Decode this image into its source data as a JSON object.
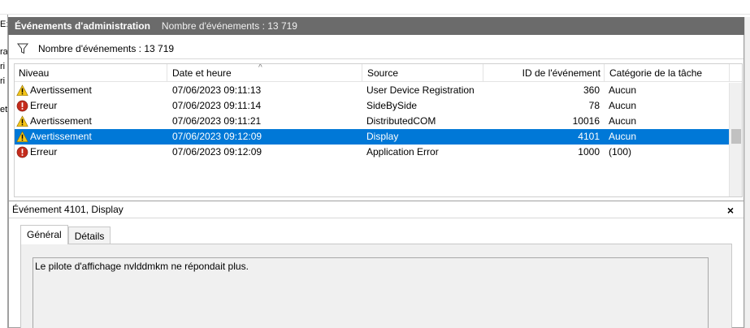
{
  "left_fragments": [
    "E:",
    "ra",
    "ri",
    "ri",
    "et"
  ],
  "header": {
    "title": "Événements d'administration",
    "count": "Nombre d'événements : 13 719"
  },
  "filterbar": {
    "icon": "filter-icon",
    "label": "Nombre d'événements : 13 719"
  },
  "columns": [
    "Niveau",
    "Date et heure",
    "Source",
    "ID de l'événement",
    "Catégorie de la tâche"
  ],
  "events": [
    {
      "level": "Avertissement",
      "icon": "warning-icon",
      "datetime": "07/06/2023 09:11:13",
      "source": "User Device Registration",
      "id": "360",
      "category": "Aucun",
      "selected": false
    },
    {
      "level": "Erreur",
      "icon": "error-icon",
      "datetime": "07/06/2023 09:11:14",
      "source": "SideBySide",
      "id": "78",
      "category": "Aucun",
      "selected": false
    },
    {
      "level": "Avertissement",
      "icon": "warning-icon",
      "datetime": "07/06/2023 09:11:21",
      "source": "DistributedCOM",
      "id": "10016",
      "category": "Aucun",
      "selected": false
    },
    {
      "level": "Avertissement",
      "icon": "warning-icon",
      "datetime": "07/06/2023 09:12:09",
      "source": "Display",
      "id": "4101",
      "category": "Aucun",
      "selected": true
    },
    {
      "level": "Erreur",
      "icon": "error-icon",
      "datetime": "07/06/2023 09:12:09",
      "source": "Application Error",
      "id": "1000",
      "category": "(100)",
      "selected": false
    }
  ],
  "detail": {
    "title": "Événement 4101, Display",
    "close": "×",
    "tabs": [
      "Général",
      "Détails"
    ],
    "active_tab": "Général",
    "message": "Le pilote d'affichage nvlddmkm ne répondait plus."
  },
  "colors": {
    "header_bg": "#6b6b6b",
    "selection": "#0078d7",
    "warning": "#f5c518",
    "error": "#c42b1c"
  }
}
